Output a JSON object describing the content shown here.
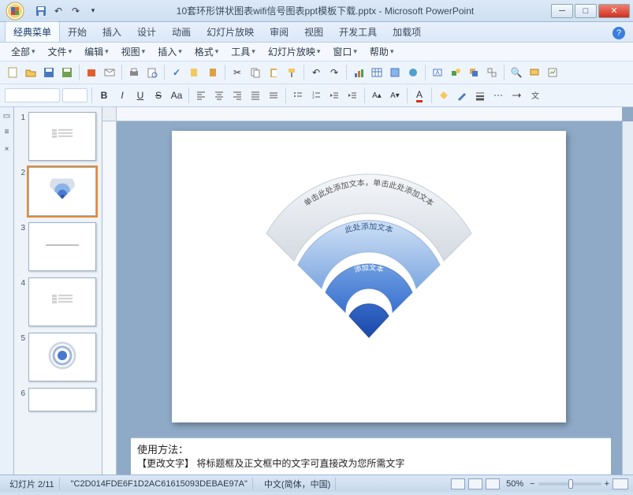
{
  "window": {
    "title": "10套环形饼状图表wifi信号图表ppt模板下载.pptx - Microsoft PowerPoint"
  },
  "ribbon_tabs": [
    "经典菜单",
    "开始",
    "插入",
    "设计",
    "动画",
    "幻灯片放映",
    "审阅",
    "视图",
    "开发工具",
    "加载项"
  ],
  "active_tab_index": 0,
  "menu": [
    "全部",
    "文件",
    "编辑",
    "视图",
    "插入",
    "格式",
    "工具",
    "幻灯片放映",
    "窗口",
    "帮助"
  ],
  "slide": {
    "arc1": "单击此处添加文本，单击此处添加文本",
    "arc2": "此处添加文本",
    "arc3": "添加文本"
  },
  "notes": {
    "line1": "使用方法：",
    "line2": "【更改文字】  将标题框及正文框中的文字可直接改为您所需文字"
  },
  "status": {
    "counter": "幻灯片 2/11",
    "id": "\"C2D014FDE6F1D2AC61615093DEBAE97A\"",
    "lang": "中文(简体，中国)",
    "zoom": "50%"
  },
  "thumbs": [
    1,
    2,
    3,
    4,
    5,
    6
  ],
  "selected_thumb": 2
}
